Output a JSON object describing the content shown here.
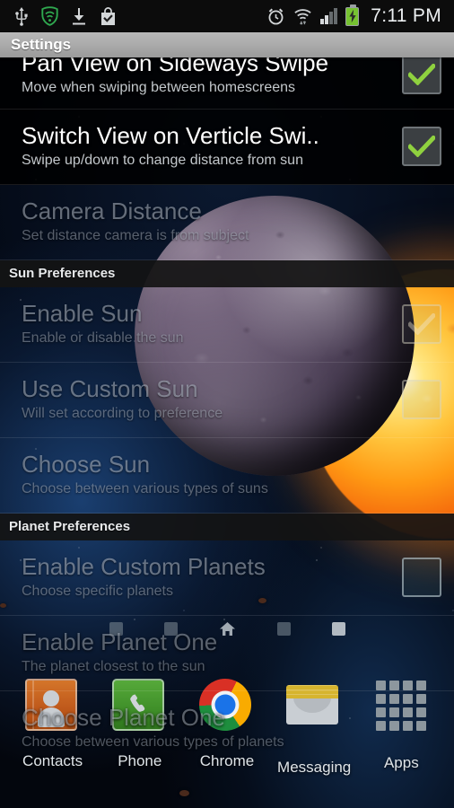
{
  "statusbar": {
    "icons_left": [
      "usb-icon",
      "vpn-shield-icon",
      "download-icon",
      "play-store-icon"
    ],
    "icons_right": [
      "alarm-icon",
      "wifi-icon",
      "signal-icon",
      "battery-charging-icon"
    ],
    "clock": "7:11 PM"
  },
  "titlebar": {
    "title": "Settings"
  },
  "rows": [
    {
      "title": "Pan View on Sideways Swipe",
      "sub": "Move when swiping between homescreens",
      "checkbox": "checked",
      "state": "enabled",
      "clipped": true
    },
    {
      "title": "Switch View on Verticle Swi..",
      "sub": "Swipe up/down to change distance from sun",
      "checkbox": "checked",
      "state": "enabled",
      "clipped": false
    },
    {
      "title": "Camera Distance",
      "sub": "Set distance camera is from subject",
      "checkbox": "none",
      "state": "disabled",
      "clipped": false
    }
  ],
  "section_sun": {
    "header": "Sun Preferences",
    "rows": [
      {
        "title": "Enable Sun",
        "sub": "Enable or disable the sun",
        "checkbox": "checked-faint",
        "state": "disabled"
      },
      {
        "title": "Use Custom Sun",
        "sub": "Will set according to preference",
        "checkbox": "unchecked-faint",
        "state": "disabled"
      },
      {
        "title": "Choose Sun",
        "sub": "Choose between various types of suns",
        "checkbox": "none",
        "state": "disabled"
      }
    ]
  },
  "section_planet": {
    "header": "Planet Preferences",
    "rows": [
      {
        "title": "Enable Custom Planets",
        "sub": "Choose specific planets",
        "checkbox": "unchecked",
        "state": "disabled"
      },
      {
        "title": "Enable Planet One",
        "sub": "The planet closest to the sun",
        "checkbox": "none",
        "state": "disabled"
      },
      {
        "title": "Choose Planet One",
        "sub": "Choose between various types of planets",
        "checkbox": "none",
        "state": "disabled"
      }
    ]
  },
  "homescreen": {
    "page_indicators": [
      "page-1",
      "page-2",
      "page-home",
      "page-4",
      "page-5-active"
    ],
    "active_page_index": 4,
    "home_page_index": 2,
    "dock": [
      {
        "label": "Contacts",
        "icon": "contacts-icon"
      },
      {
        "label": "Phone",
        "icon": "phone-icon"
      },
      {
        "label": "Chrome",
        "icon": "chrome-icon"
      },
      {
        "label": "Messaging",
        "icon": "messaging-icon"
      },
      {
        "label": "Apps",
        "icon": "apps-grid-icon"
      }
    ]
  },
  "colors": {
    "accent_check": "#8fd13f",
    "titlebar": "#acacac",
    "statusbar": "#0c0c0c",
    "battery_green": "#76c231",
    "section_header_bg": "#141414"
  }
}
